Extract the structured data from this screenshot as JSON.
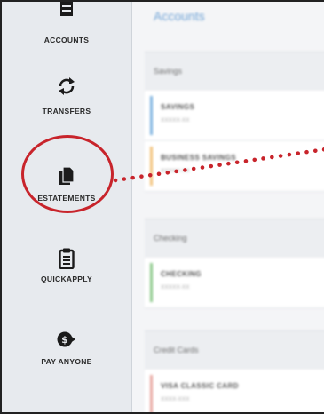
{
  "sidebar": {
    "items": [
      {
        "id": "accounts",
        "label": "ACCOUNTS",
        "icon": "card-stack-icon"
      },
      {
        "id": "transfers",
        "label": "TRANSFERS",
        "icon": "refresh-arrows-icon"
      },
      {
        "id": "estatements",
        "label": "ESTATEMENTS",
        "icon": "documents-icon"
      },
      {
        "id": "quickapply",
        "label": "QUICKAPPLY",
        "icon": "clipboard-icon"
      },
      {
        "id": "payanyone",
        "label": "PAY ANYONE",
        "icon": "pay-person-icon"
      }
    ]
  },
  "main": {
    "title": "Accounts",
    "groups": [
      {
        "label": "Savings",
        "accounts": [
          {
            "name": "SAVINGS",
            "number": "XXXXX-XX",
            "color": "#7eb3e0"
          },
          {
            "name": "BUSINESS SAVINGS",
            "number": "XXXXX-XX",
            "color": "#f2c27a"
          }
        ]
      },
      {
        "label": "Checking",
        "accounts": [
          {
            "name": "CHECKING",
            "number": "XXXXX-XX",
            "color": "#8cc98a"
          }
        ]
      },
      {
        "label": "Credit Cards",
        "accounts": [
          {
            "name": "VISA CLASSIC CARD",
            "number": "XXXX-XXX",
            "color": "#e8a7a0"
          }
        ]
      }
    ]
  },
  "colors": {
    "highlight": "#c8242b",
    "sidebar_bg": "#e7eaee",
    "accent": "#6fa3d6"
  }
}
